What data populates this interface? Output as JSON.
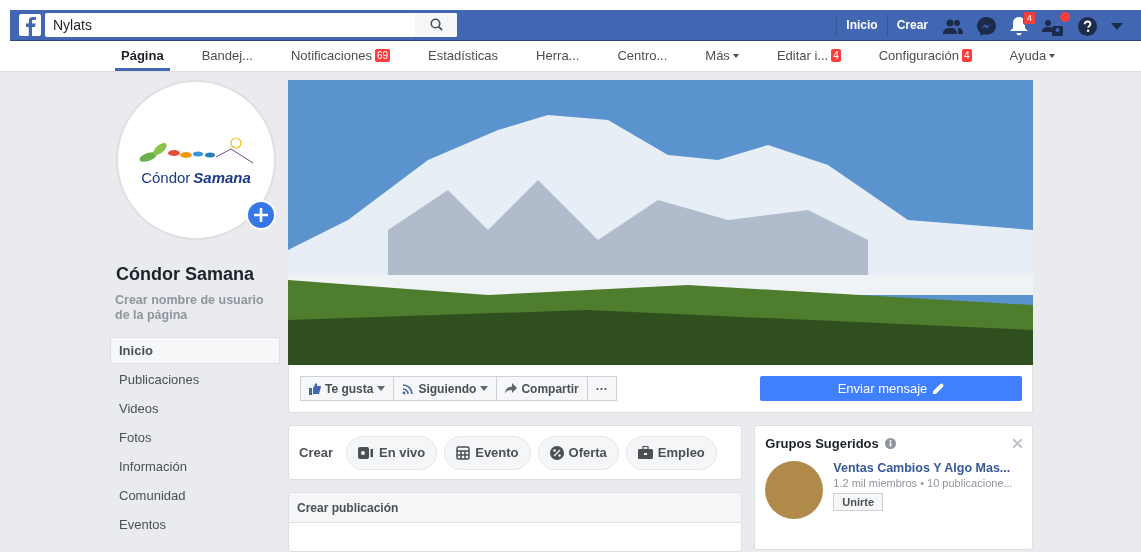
{
  "topbar": {
    "search": {
      "value": "Nylats"
    },
    "links": [
      "Inicio",
      "Crear"
    ],
    "notification_badge": "4",
    "requests_dot": true
  },
  "subnav": {
    "tabs": [
      {
        "label": "Página",
        "selected": true
      },
      {
        "label": "Bandej...",
        "selected": false
      },
      {
        "label": "Notificaciones",
        "selected": false,
        "badge": "69"
      },
      {
        "label": "Estadísticas",
        "selected": false
      },
      {
        "label": "Herra...",
        "selected": false
      },
      {
        "label": "Centro...",
        "selected": false
      },
      {
        "label": "Más",
        "selected": false,
        "dropdown": true
      },
      {
        "label": "Editar i...",
        "selected": false,
        "badge": "4"
      },
      {
        "label": "Configuración",
        "selected": false,
        "badge": "4"
      },
      {
        "label": "Ayuda",
        "selected": false,
        "dropdown": true
      }
    ]
  },
  "profile": {
    "logo_text": [
      "Cóndor",
      "Samana"
    ],
    "name": "Cóndor Samana",
    "username_hint": "Crear nombre de usuario de la página"
  },
  "sidebar": {
    "items": [
      {
        "label": "Inicio",
        "selected": true
      },
      {
        "label": "Publicaciones",
        "selected": false
      },
      {
        "label": "Videos",
        "selected": false
      },
      {
        "label": "Fotos",
        "selected": false
      },
      {
        "label": "Información",
        "selected": false
      },
      {
        "label": "Comunidad",
        "selected": false
      },
      {
        "label": "Eventos",
        "selected": false
      }
    ]
  },
  "actions": {
    "buttons": [
      {
        "kind": "like",
        "label": "Te gusta",
        "dropdown": true
      },
      {
        "kind": "follow",
        "label": "Siguiendo",
        "dropdown": true
      },
      {
        "kind": "share",
        "label": "Compartir",
        "dropdown": false
      },
      {
        "kind": "more",
        "label": "···",
        "dropdown": false
      }
    ],
    "message_button": "Enviar mensaje"
  },
  "create": {
    "label": "Crear",
    "buttons": [
      {
        "kind": "live",
        "label": "En vivo"
      },
      {
        "kind": "event",
        "label": "Evento"
      },
      {
        "kind": "offer",
        "label": "Oferta"
      },
      {
        "kind": "job",
        "label": "Empleo"
      }
    ]
  },
  "post_composer": {
    "title": "Crear publicación"
  },
  "suggested_groups": {
    "title": "Grupos Sugeridos",
    "groups": [
      {
        "name": "Ventas Cambios Y Algo Mas...",
        "meta": "1.2 mil miembros • 10 publicacione...",
        "join": "Unirte"
      }
    ]
  }
}
